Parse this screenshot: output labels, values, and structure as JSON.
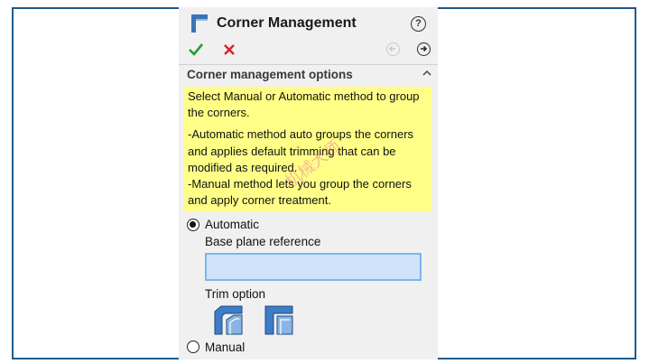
{
  "panel": {
    "title": "Corner Management",
    "help_icon_glyph": "?"
  },
  "actions": {
    "ok_icon": "checkmark-icon",
    "cancel_icon": "close-icon",
    "back_icon": "back-arrow-icon",
    "next_icon": "next-arrow-icon"
  },
  "section": {
    "header": "Corner management options",
    "note_lines": [
      "Select Manual or Automatic method to group the corners.",
      "-Automatic method auto groups the corners and applies default trimming that can be modified as required.",
      "-Manual method lets you group the corners and apply corner treatment."
    ],
    "note_color": "#ffff88"
  },
  "options": {
    "automatic_label": "Automatic",
    "automatic_selected": true,
    "base_plane_label": "Base plane reference",
    "base_plane_value": "",
    "trim_label": "Trim option",
    "manual_label": "Manual",
    "manual_selected": false
  },
  "watermark": "机械大师"
}
